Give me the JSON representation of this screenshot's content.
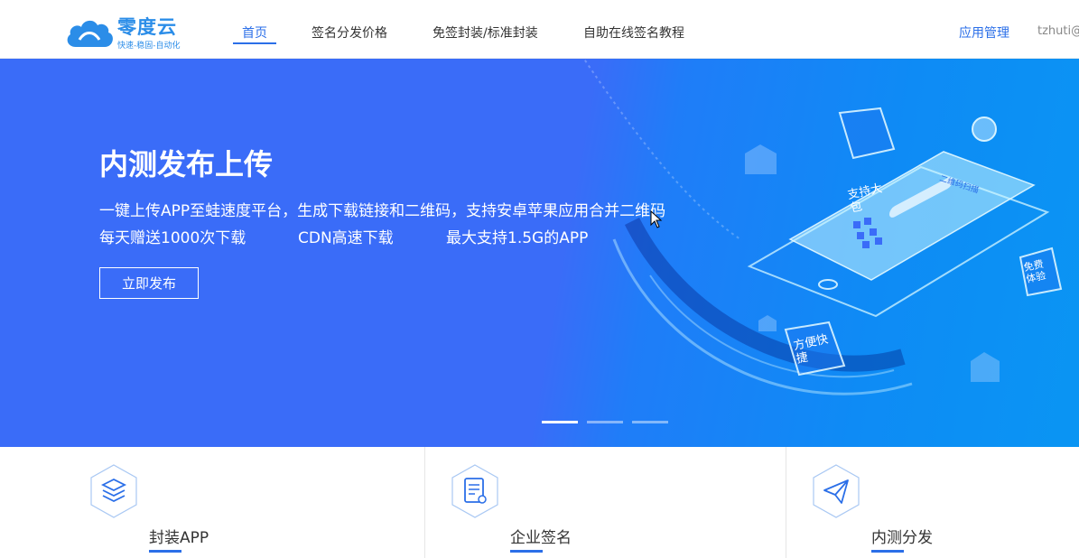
{
  "header": {
    "logo": {
      "title": "零度云",
      "slogan": "快速-稳固-自动化"
    },
    "nav": [
      {
        "label": "首页",
        "active": true
      },
      {
        "label": "签名分发价格",
        "active": false
      },
      {
        "label": "免签封装/标准封装",
        "active": false
      },
      {
        "label": "自助在线签名教程",
        "active": false
      }
    ],
    "app_manage": "应用管理",
    "user": "tzhuti@"
  },
  "banner": {
    "title": "内测发布上传",
    "description": "一键上传APP至蛙速度平台，生成下载链接和二维码，支持安卓苹果应用合并二维码",
    "features": [
      "每天赠送1000次下载",
      "CDN高速下载",
      "最大支持1.5G的APP"
    ],
    "cta_label": "立即发布",
    "badges": [
      "支持大包",
      "免费体验",
      "方便快捷"
    ],
    "phone_label": "二维码扫描",
    "carousel_active": 0,
    "colors": {
      "left": "#3a6cf8",
      "right": "#0a95f3"
    }
  },
  "services": [
    {
      "label": "封装APP",
      "icon": "layers-icon"
    },
    {
      "label": "企业签名",
      "icon": "certificate-icon"
    },
    {
      "label": "内测分发",
      "icon": "paper-plane-icon"
    }
  ],
  "accent": "#2b6fe8"
}
